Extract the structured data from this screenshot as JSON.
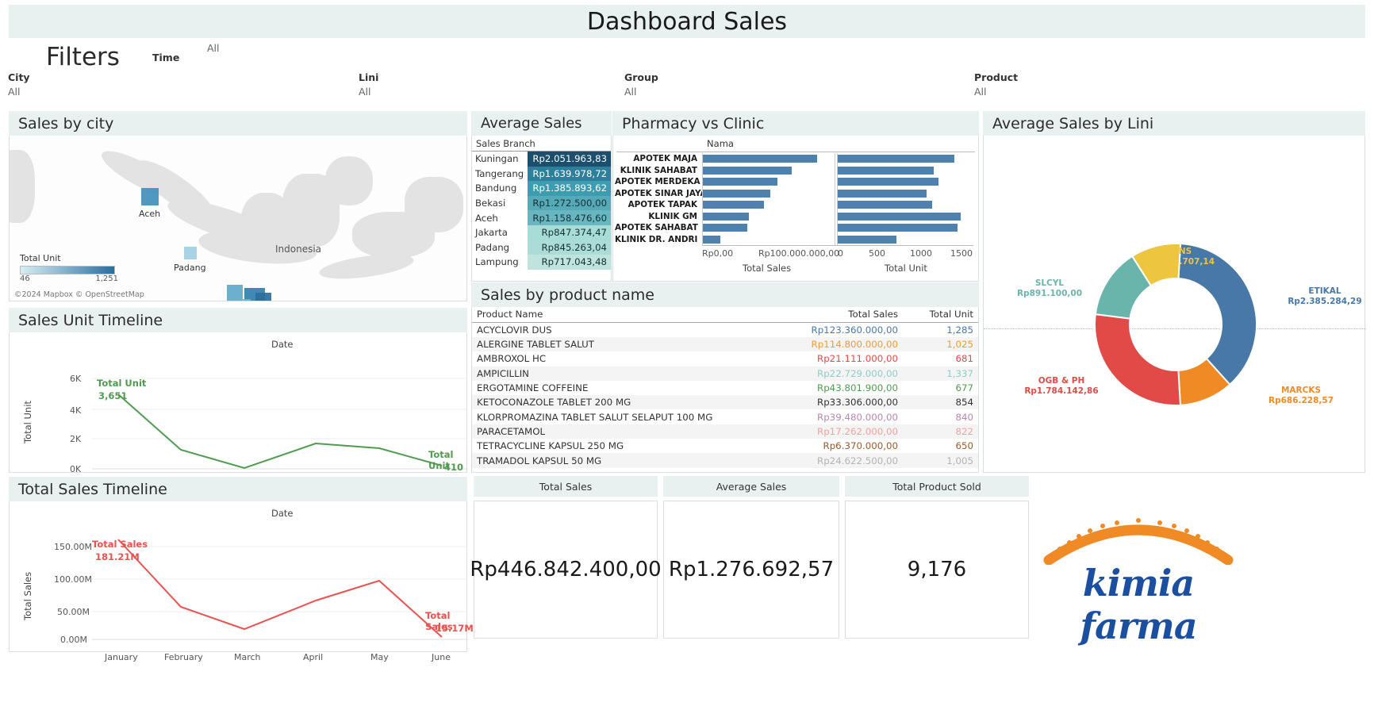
{
  "title": "Dashboard Sales",
  "filters": {
    "heading": "Filters",
    "time_label": "Time",
    "time_value": "All",
    "items": [
      {
        "label": "City",
        "value": "All"
      },
      {
        "label": "Lini",
        "value": "All"
      },
      {
        "label": "Group",
        "value": "All"
      },
      {
        "label": "Product",
        "value": "All"
      }
    ]
  },
  "map": {
    "title": "Sales by city",
    "legend_title": "Total Unit",
    "legend_min": "46",
    "legend_max": "1,251",
    "attribution": "©2024 Mapbox © OpenStreetMap",
    "country_label": "Indonesia",
    "city_labels": [
      "Aceh",
      "Padang"
    ]
  },
  "avg_sales": {
    "title": "Average Sales",
    "column_header": "Sales Branch",
    "rows": [
      {
        "branch": "Kuningan",
        "value": "Rp2.051.963,83",
        "bg": "#1c4f6e",
        "fg": "#ffffff"
      },
      {
        "branch": "Tangerang",
        "value": "Rp1.639.978,72",
        "bg": "#2e7f9c",
        "fg": "#ffffff"
      },
      {
        "branch": "Bandung",
        "value": "Rp1.385.893,62",
        "bg": "#3e9cb0",
        "fg": "#ffffff"
      },
      {
        "branch": "Bekasi",
        "value": "Rp1.272.500,00",
        "bg": "#56aab8",
        "fg": "#153037"
      },
      {
        "branch": "Aceh",
        "value": "Rp1.158.476,60",
        "bg": "#68b6c0",
        "fg": "#153037"
      },
      {
        "branch": "Jakarta",
        "value": "Rp847.374,47",
        "bg": "#a8dcd7",
        "fg": "#153037"
      },
      {
        "branch": "Padang",
        "value": "Rp845.263,04",
        "bg": "#abdcd7",
        "fg": "#153037"
      },
      {
        "branch": "Lampung",
        "value": "Rp717.043,48",
        "bg": "#bfe4dd",
        "fg": "#153037"
      }
    ]
  },
  "pharmacy_vs_clinic": {
    "title": "Pharmacy vs Clinic",
    "name_header": "Nama",
    "left_axis_title": "Total Sales",
    "right_axis_title": "Total Unit",
    "left_ticks": [
      "Rp0,00",
      "Rp100.000.000,00"
    ],
    "right_ticks": [
      "0",
      "500",
      "1000",
      "1500"
    ],
    "chart_data": {
      "type": "bar",
      "title": "Pharmacy vs Clinic",
      "categories": [
        "APOTEK MAJA",
        "KLINIK SAHABAT",
        "APOTEK MERDEKA",
        "APOTEK SINAR JAYA",
        "APOTEK TAPAK",
        "KLINIK GM",
        "APOTEK SAHABAT",
        "KLINIK DR. ANDRI"
      ],
      "series": [
        {
          "name": "Total Sales",
          "values": [
            90000000,
            70000000,
            59000000,
            53000000,
            48000000,
            36000000,
            35000000,
            14000000
          ],
          "xlabel": "Total Sales",
          "xlim": [
            0,
            100000000
          ]
        },
        {
          "name": "Total Unit",
          "values": [
            1560,
            1280,
            1350,
            1190,
            1260,
            1640,
            1600,
            790
          ],
          "xlabel": "Total Unit",
          "xlim": [
            0,
            1750
          ]
        }
      ],
      "grid": true,
      "legend": "none"
    }
  },
  "products": {
    "title": "Sales by product name",
    "headers": [
      "Product Name",
      "Total Sales",
      "Total Unit"
    ],
    "rows": [
      {
        "name": "ACYCLOVIR DUS",
        "sales": "Rp123.360.000,00",
        "unit": "1,285",
        "color": "#4878a8"
      },
      {
        "name": "ALERGINE TABLET SALUT",
        "sales": "Rp114.800.000,00",
        "unit": "1,025",
        "color": "#ee9b3a"
      },
      {
        "name": "AMBROXOL HC",
        "sales": "Rp21.111.000,00",
        "unit": "681",
        "color": "#e24a48"
      },
      {
        "name": "AMPICILLIN",
        "sales": "Rp22.729.000,00",
        "unit": "1,337",
        "color": "#8fcec6"
      },
      {
        "name": "ERGOTAMINE COFFEINE",
        "sales": "Rp43.801.900,00",
        "unit": "677",
        "color": "#4f9c4f"
      },
      {
        "name": "KETOCONAZOLE TABLET 200 MG",
        "sales": "Rp33.306.000,00",
        "unit": "854",
        "color": "#edc килок"
      },
      {
        "name": "KLORPROMAZINA TABLET SALUT SELAPUT 100 MG",
        "sales": "Rp39.480.000,00",
        "unit": "840",
        "color": "#b986b2"
      },
      {
        "name": "PARACETAMOL",
        "sales": "Rp17.262.000,00",
        "unit": "822",
        "color": "#f4a0a0"
      },
      {
        "name": "TETRACYCLINE KAPSUL 250 MG",
        "sales": "Rp6.370.000,00",
        "unit": "650",
        "color": "#9c5a2c"
      },
      {
        "name": "TRAMADOL KAPSUL 50 MG",
        "sales": "Rp24.622.500,00",
        "unit": "1,005",
        "color": "#b3b3b3"
      }
    ]
  },
  "unit_timeline": {
    "title": "Sales Unit Timeline",
    "x_axis_title": "Date",
    "y_axis_title": "Total Unit",
    "start_label": "Total Unit",
    "end_label": "Total Unit",
    "chart_data": {
      "type": "line",
      "title": "Sales Unit Timeline",
      "x": [
        "January",
        "February",
        "March",
        "April",
        "May",
        "June"
      ],
      "series": [
        {
          "name": "Total Unit",
          "values": [
            3651,
            1320,
            330,
            1690,
            1430,
            410
          ],
          "color": "#4f9c4f"
        }
      ],
      "start_value_label": "3,651",
      "end_value_label": "410",
      "yticks": [
        "0K",
        "2K",
        "4K",
        "6K"
      ],
      "ylim": [
        0,
        6000
      ],
      "xlabel": "Date",
      "ylabel": "Total Unit"
    }
  },
  "sales_timeline": {
    "title": "Total Sales Timeline",
    "x_axis_title": "Date",
    "y_axis_title": "Total Sales",
    "start_label": "Total Sales",
    "end_label": "Total Sales",
    "chart_data": {
      "type": "line",
      "title": "Total Sales Timeline",
      "x": [
        "January",
        "February",
        "March",
        "April",
        "May",
        "June"
      ],
      "series": [
        {
          "name": "Total Sales",
          "values": [
            181210000,
            57000000,
            16000000,
            72000000,
            96000000,
            15170000
          ],
          "color": "#e8534f"
        }
      ],
      "start_value_label": "181.21M",
      "end_value_label": "15.17M",
      "yticks": [
        "0.00M",
        "50.00M",
        "100.00M",
        "150.00M"
      ],
      "ylim": [
        0,
        190000000
      ],
      "xlabel": "Date",
      "ylabel": "Total Sales"
    }
  },
  "lini": {
    "title": "Average Sales by Lini",
    "chart_data": {
      "type": "pie",
      "title": "Average Sales by Lini",
      "labels": [
        "ETIKAL",
        "MARCKS",
        "OGB & PH",
        "SLCYL",
        "VNS"
      ],
      "value_labels": [
        "Rp2.385.284,29",
        "Rp686.228,57",
        "Rp1.784.142,86",
        "Rp891.100,00",
        "Rp636.707,14"
      ],
      "values": [
        2385284.29,
        686228.57,
        1784142.86,
        891100.0,
        636707.14
      ],
      "colors": [
        "#4878a8",
        "#f08a24",
        "#e24a48",
        "#6ab5ab",
        "#edc53f"
      ],
      "donut": true
    }
  },
  "kpis": [
    {
      "caption": "Total Sales",
      "value": "Rp446.842.400,00"
    },
    {
      "caption": "Average Sales",
      "value": "Rp1.276.692,57"
    },
    {
      "caption": "Total Product Sold",
      "value": "9,176"
    }
  ],
  "logo": {
    "text": "kimia farma"
  }
}
